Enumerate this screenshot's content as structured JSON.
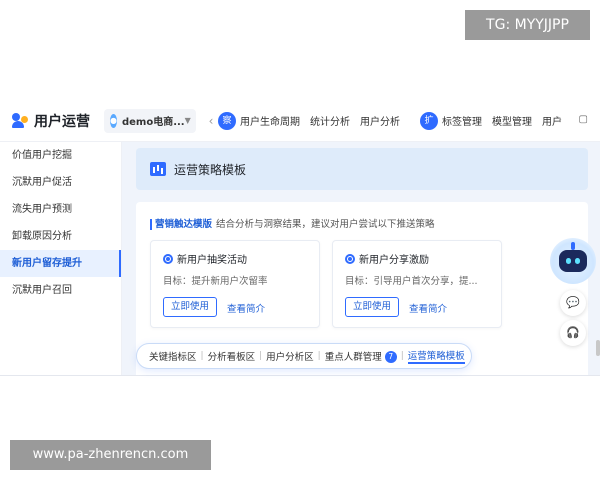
{
  "watermarks": {
    "top": "TG: MYYJJPP",
    "bottom": "www.pa-zhenrencn.com"
  },
  "header": {
    "app_title": "用户运营",
    "project": "demo电商...",
    "nav_groups": [
      {
        "badge": "察",
        "items": [
          "用户生命周期",
          "统计分析",
          "用户分析"
        ]
      },
      {
        "badge": "扩",
        "items": [
          "标签管理",
          "模型管理",
          "用户"
        ]
      }
    ],
    "right_arrow": "›",
    "left_arrow": "‹"
  },
  "sidebar": {
    "items": [
      {
        "label": "价值用户挖掘",
        "active": false
      },
      {
        "label": "沉默用户促活",
        "active": false
      },
      {
        "label": "流失用户预测",
        "active": false
      },
      {
        "label": "卸载原因分析",
        "active": false
      },
      {
        "label": "新用户留存提升",
        "active": true
      },
      {
        "label": "沉默用户召回",
        "active": false
      }
    ]
  },
  "main": {
    "section_title": "运营策略模板",
    "marketing_tag": "营销触达模版",
    "marketing_desc": "结合分析与洞察结果，建议对用户尝试以下推送策略",
    "cards": [
      {
        "title": "新用户抽奖活动",
        "goal": "目标：提升新用户次留率",
        "use_label": "立即使用",
        "intro_label": "查看简介"
      },
      {
        "title": "新用户分享激励",
        "goal": "目标：引导用户首次分享，提...",
        "use_label": "立即使用",
        "intro_label": "查看简介"
      }
    ]
  },
  "float_tabs": {
    "items": [
      {
        "label": "关键指标区"
      },
      {
        "label": "分析看板区"
      },
      {
        "label": "用户分析区"
      },
      {
        "label": "重点人群管理",
        "badge": "7"
      },
      {
        "label": "运营策略模板",
        "active": true
      }
    ]
  },
  "colors": {
    "accent": "#2f6bff",
    "active_bg": "#e8f1ff",
    "main_bg": "#f0f4fb"
  }
}
